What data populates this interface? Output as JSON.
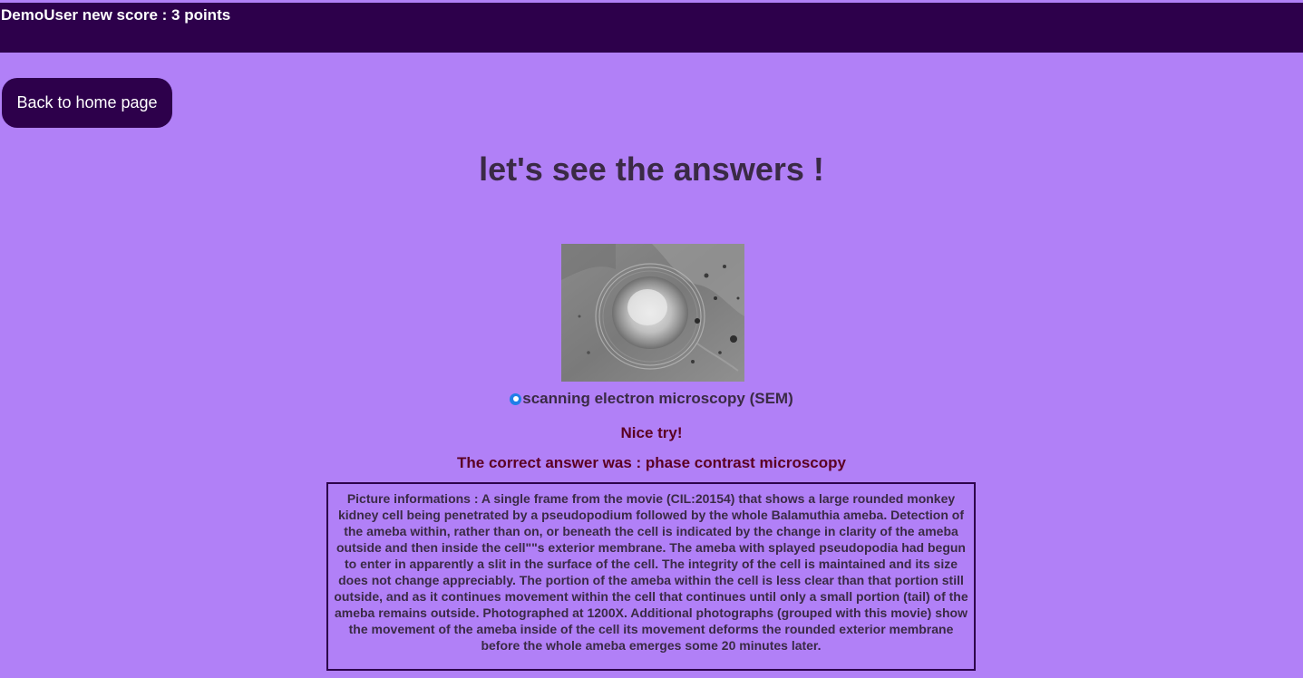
{
  "header": {
    "score_text": "DemoUser new score : 3 points"
  },
  "nav": {
    "home_button": "Back to home page"
  },
  "main": {
    "title": "let's see the answers !",
    "selected_answer": "scanning electron microscopy (SEM)",
    "feedback": "Nice try!",
    "correct_answer": "The correct answer was : phase contrast microscopy",
    "picture_info": "Picture informations : A single frame from the movie (CIL:20154) that shows a large rounded monkey kidney cell being penetrated by a pseudopodium followed by the whole Balamuthia ameba. Detection of the ameba within, rather than on, or beneath the cell is indicated by the change in clarity of the ameba outside and then inside the cell\"\"s exterior membrane. The ameba with splayed pseudopodia had begun to enter in apparently a slit in the surface of the cell. The integrity of the cell is maintained and its size does not change appreciably. The portion of the ameba within the cell is less clear than that portion still outside, and as it continues movement within the cell that continues until only a small portion (tail) of the ameba remains outside. Photographed at 1200X. Additional photographs (grouped with this movie) show the movement of the ameba inside of the cell its movement deforms the rounded exterior membrane before the whole ameba emerges some 20 minutes later."
  },
  "colors": {
    "background": "#b180f7",
    "header": "#2d004b",
    "feedback_text": "#5a0022",
    "radio_selected": "#1f7fe8"
  },
  "icons": {
    "answer_radio": "radio-selected"
  }
}
